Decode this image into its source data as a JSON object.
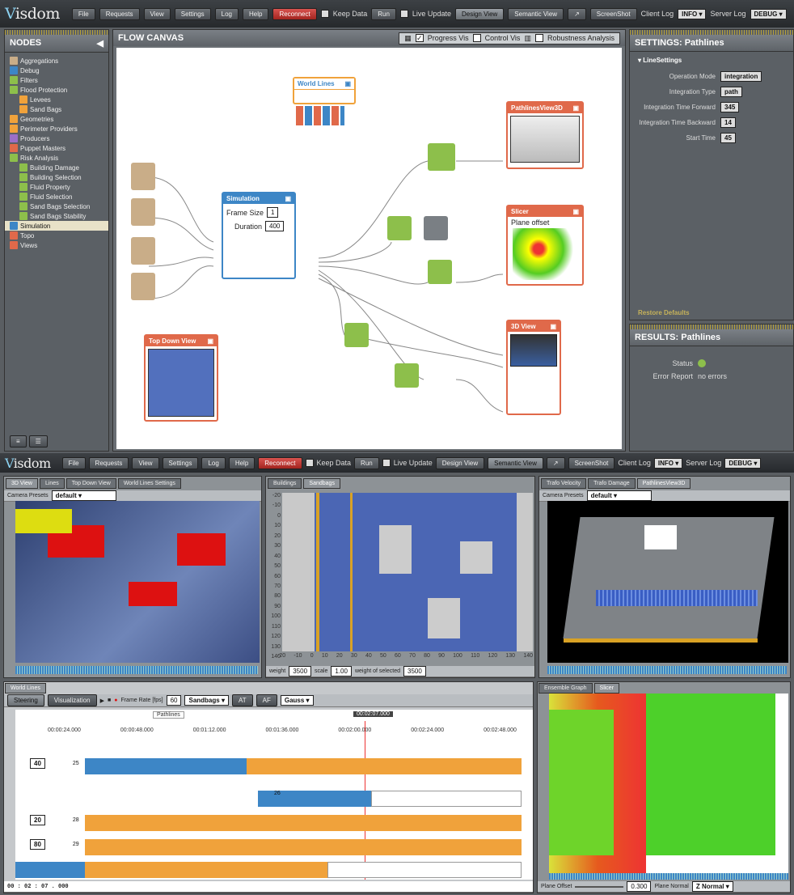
{
  "app": {
    "logo_prefix": "V",
    "logo_text": "isdom"
  },
  "menu": {
    "items": [
      "File",
      "Requests",
      "View",
      "Settings",
      "Log",
      "Help"
    ],
    "reconnect": "Reconnect",
    "keep_data": "Keep Data",
    "run": "Run",
    "live_update": "Live Update",
    "design_view": "Design View",
    "semantic_view": "Semantic View",
    "screenshot": "ScreenShot",
    "client_log": "Client Log",
    "client_log_level": "INFO",
    "server_log": "Server Log",
    "server_log_level": "DEBUG"
  },
  "nodes_panel": {
    "title": "NODES",
    "items": [
      {
        "label": "Aggregations",
        "color": "#c9ad88",
        "indent": 0
      },
      {
        "label": "Debug",
        "color": "#3d86c6",
        "indent": 0
      },
      {
        "label": "Filters",
        "color": "#8dbf4b",
        "indent": 0
      },
      {
        "label": "Flood Protection",
        "color": "#8dbf4b",
        "indent": 0
      },
      {
        "label": "Levees",
        "color": "#f0a23b",
        "indent": 1
      },
      {
        "label": "Sand Bags",
        "color": "#f0a23b",
        "indent": 1
      },
      {
        "label": "Geometries",
        "color": "#f0a23b",
        "indent": 0
      },
      {
        "label": "Perimeter Providers",
        "color": "#f0a23b",
        "indent": 0
      },
      {
        "label": "Producers",
        "color": "#9b6fc7",
        "indent": 0
      },
      {
        "label": "Puppet Masters",
        "color": "#e0694a",
        "indent": 0
      },
      {
        "label": "Risk Analysis",
        "color": "#8dbf4b",
        "indent": 0
      },
      {
        "label": "Building Damage",
        "color": "#8dbf4b",
        "indent": 1
      },
      {
        "label": "Building Selection",
        "color": "#8dbf4b",
        "indent": 1
      },
      {
        "label": "Fluid Property",
        "color": "#8dbf4b",
        "indent": 1
      },
      {
        "label": "Fluid Selection",
        "color": "#8dbf4b",
        "indent": 1
      },
      {
        "label": "Sand Bags Selection",
        "color": "#8dbf4b",
        "indent": 1
      },
      {
        "label": "Sand Bags Stability",
        "color": "#8dbf4b",
        "indent": 1
      },
      {
        "label": "Simulation",
        "color": "#3d86c6",
        "indent": 0
      },
      {
        "label": "Topo",
        "color": "#e0694a",
        "indent": 0
      },
      {
        "label": "Views",
        "color": "#e0694a",
        "indent": 0
      }
    ]
  },
  "canvas": {
    "title": "FLOW CANVAS",
    "progress_vis": "Progress Vis",
    "control_vis": "Control Vis",
    "robustness": "Robustness Analysis",
    "nodes": {
      "world_lines": "World Lines",
      "simulation": "Simulation",
      "frame_size_label": "Frame Size",
      "frame_size_value": "1",
      "duration_label": "Duration",
      "duration_value": "400",
      "pathlines_view": "PathlinesView3D",
      "slicer": "Slicer",
      "plane_offset": "Plane offset",
      "view3d": "3D View",
      "top_down": "Top Down View"
    }
  },
  "settings": {
    "title": "SETTINGS: Pathlines",
    "group": "LineSettings",
    "rows": [
      {
        "label": "Operation Mode",
        "value": "integration"
      },
      {
        "label": "Integration Type",
        "value": "path"
      },
      {
        "label": "Integration Time Forward",
        "value": "345"
      },
      {
        "label": "Integration Time Backward",
        "value": "14"
      },
      {
        "label": "Start Time",
        "value": "45"
      }
    ],
    "restore": "Restore Defaults"
  },
  "results": {
    "title": "RESULTS: Pathlines",
    "status_label": "Status",
    "error_label": "Error Report",
    "error_value": "no errors"
  },
  "bottom": {
    "left_tabs": [
      "3D View",
      "Lines",
      "Top Down View",
      "World Lines Settings"
    ],
    "camera_presets": "Camera Presets",
    "camera_default": "default",
    "mid_tabs": [
      "Buildings",
      "Sandbags"
    ],
    "y_ticks": [
      "-20",
      "-10",
      "0",
      "10",
      "20",
      "30",
      "40",
      "50",
      "60",
      "70",
      "80",
      "90",
      "100",
      "110",
      "120",
      "130",
      "140"
    ],
    "x_ticks": [
      "-20",
      "-10",
      "0",
      "10",
      "20",
      "30",
      "40",
      "50",
      "60",
      "70",
      "80",
      "90",
      "100",
      "110",
      "120",
      "130",
      "140"
    ],
    "weight_label": "weight",
    "weight_value": "3500",
    "scale_label": "scale",
    "scale_value": "1.00",
    "weight_sel_label": "weight of selected",
    "weight_sel_value": "3500",
    "right_tabs": [
      "Trafo Velocity",
      "Trafo Damage",
      "PathlinesView3D"
    ],
    "worldlines_tab": "World Lines",
    "steering": "Steering",
    "visualization": "Visualization",
    "frame_rate_label": "Frame Rate [fps]",
    "frame_rate_value": "60",
    "sandbags": "Sandbags",
    "at": "AT",
    "af": "AF",
    "gauss": "Gauss",
    "pathlines_tag": "Pathlines",
    "current_time": "00:02:07.000",
    "time_ticks": [
      "00:00:24.000",
      "00:00:48.000",
      "00:01:12.000",
      "00:01:36.000",
      "00:02:00.000",
      "00:02:24.000",
      "00:02:48.000"
    ],
    "lanes": [
      {
        "num": "40",
        "id": "25"
      },
      {
        "num": "",
        "id": "26"
      },
      {
        "num": "20",
        "id": "28"
      },
      {
        "num": "80",
        "id": "29"
      }
    ],
    "time_readout": "00 : 02 : 07 . 000",
    "graph_tabs": [
      "Ensemble Graph",
      "Slicer"
    ],
    "plane_offset_label": "Plane Offset",
    "plane_offset_value": "0.300",
    "plane_normal_label": "Plane Normal",
    "plane_normal_value": "Z Normal"
  }
}
